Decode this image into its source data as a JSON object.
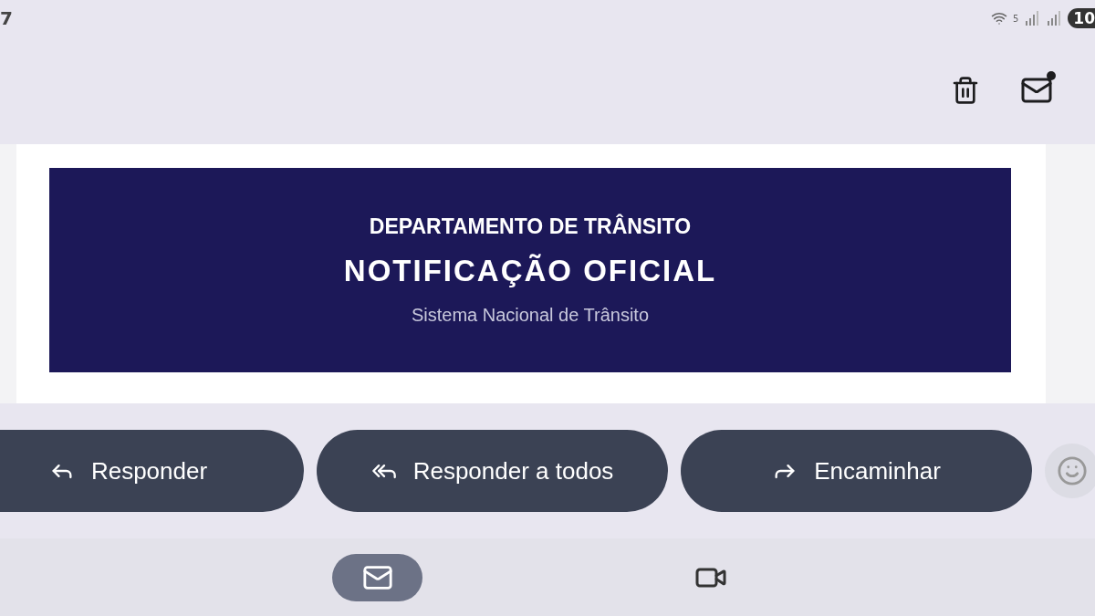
{
  "status_bar": {
    "time": "7",
    "wifi_label": "5",
    "battery": "10"
  },
  "toolbar": {
    "actions": [
      {
        "kind": "delete"
      },
      {
        "kind": "mark_unread"
      }
    ]
  },
  "email_banner": {
    "organization": "DEPARTAMENTO DE TRÂNSITO",
    "title": "NOTIFICAÇÃO OFICIAL",
    "subtitle": "Sistema Nacional de Trânsito"
  },
  "reply_actions": [
    {
      "kind": "reply",
      "label": "Responder"
    },
    {
      "kind": "reply_all",
      "label": "Responder a todos"
    },
    {
      "kind": "forward",
      "label": "Encaminhar"
    }
  ],
  "bottom_nav": [
    {
      "kind": "mail",
      "selected": true
    },
    {
      "kind": "video",
      "selected": false
    }
  ]
}
